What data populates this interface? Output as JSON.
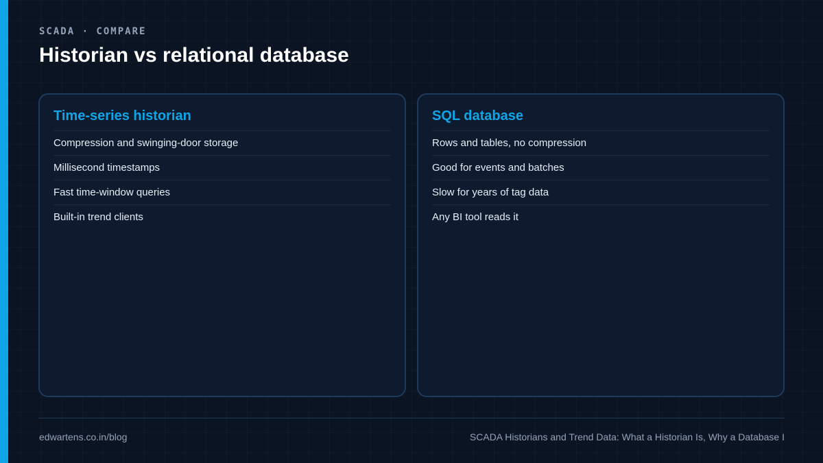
{
  "header": {
    "eyebrow": "SCADA · COMPARE",
    "title": "Historian vs relational database"
  },
  "panels": [
    {
      "title": "Time-series historian",
      "items": [
        "Compression and swinging-door storage",
        "Millisecond timestamps",
        "Fast time-window queries",
        "Built-in trend clients"
      ]
    },
    {
      "title": "SQL database",
      "items": [
        "Rows and tables, no compression",
        "Good for events and batches",
        "Slow for years of tag data",
        "Any BI tool reads it"
      ]
    }
  ],
  "footer": {
    "site": "edwartens.co.in/blog",
    "article": "SCADA Historians and Trend Data: What a Historian Is, Why a Database I"
  },
  "colors": {
    "accent": "#0ea5e9",
    "background": "#0b1422",
    "panel_border": "#1e3a5c"
  }
}
